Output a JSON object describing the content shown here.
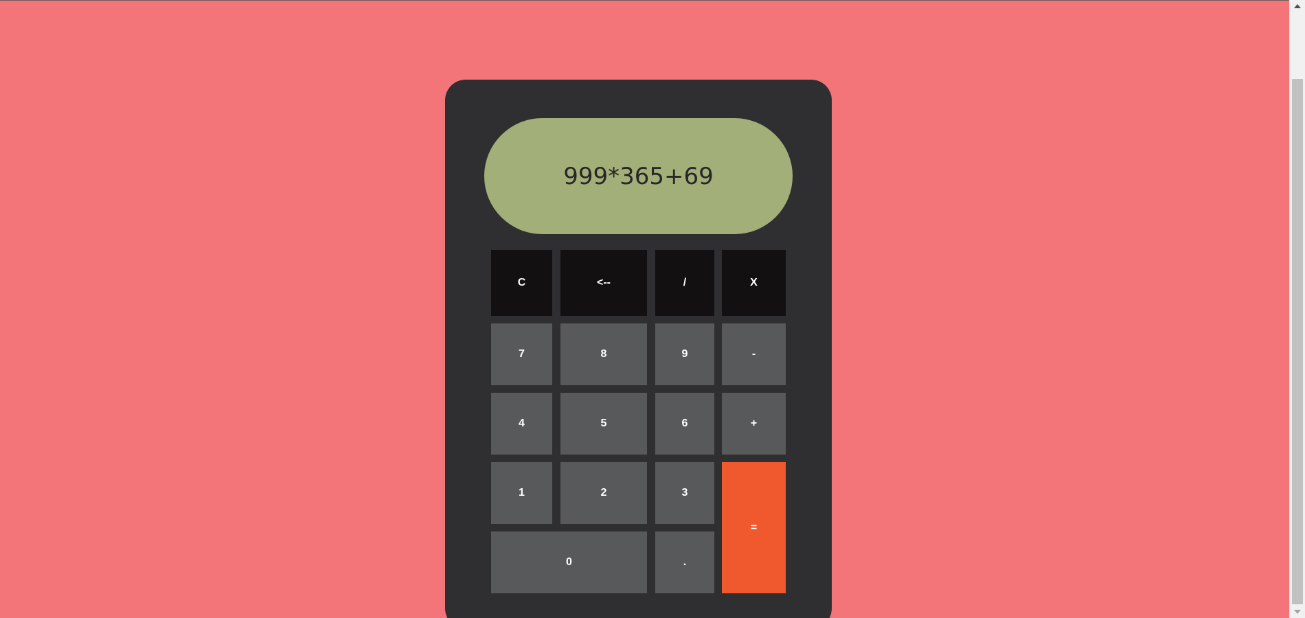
{
  "colors": {
    "page_background": "#f37479",
    "calculator_body": "#2f2f31",
    "display_background": "#a2af78",
    "display_text": "#262626",
    "key_dark": "#121011",
    "key_gray": "#58595b",
    "key_equals": "#f0592d",
    "key_text": "#ffffff"
  },
  "display": {
    "value": "999*365+69"
  },
  "keys": {
    "clear": "C",
    "backspace": "<--",
    "divide": "/",
    "multiply": "X",
    "seven": "7",
    "eight": "8",
    "nine": "9",
    "minus": "-",
    "four": "4",
    "five": "5",
    "six": "6",
    "plus": "+",
    "one": "1",
    "two": "2",
    "three": "3",
    "equals": "=",
    "zero": "0",
    "decimal": "."
  },
  "icons": {
    "scroll_up": "chevron-up-icon",
    "scroll_down": "chevron-down-icon"
  }
}
